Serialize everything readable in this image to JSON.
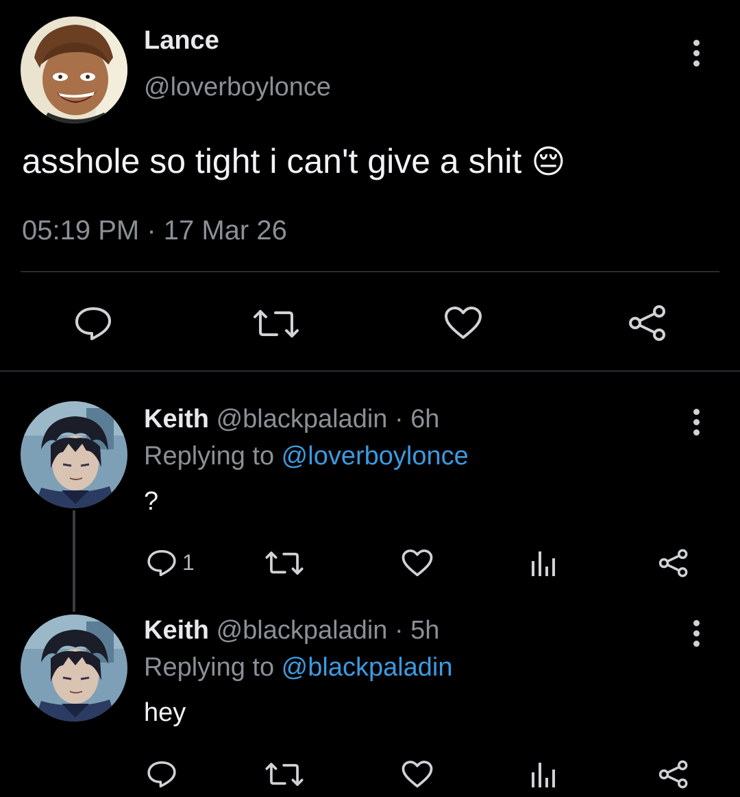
{
  "main_tweet": {
    "display_name": "Lance",
    "handle": "@loverboylonce",
    "text": "asshole so tight i can't give a shit",
    "emoji": "😔",
    "timestamp": "05:19 PM · 17 Mar 26",
    "actions": [
      "reply-icon",
      "retweet-icon",
      "like-icon",
      "share-icon"
    ]
  },
  "replies": [
    {
      "display_name": "Keith",
      "handle_time": "@blackpaladin · 6h",
      "replying_prefix": "Replying to ",
      "replying_to": "@loverboylonce",
      "text": "?",
      "reply_count": "1",
      "actions": [
        "reply-icon",
        "retweet-icon",
        "like-icon",
        "analytics-icon",
        "share-icon"
      ]
    },
    {
      "display_name": "Keith",
      "handle_time": "@blackpaladin · 5h",
      "replying_prefix": "Replying to ",
      "replying_to": "@blackpaladin",
      "text": "hey",
      "reply_count": "",
      "actions": [
        "reply-icon",
        "retweet-icon",
        "like-icon",
        "analytics-icon",
        "share-icon"
      ]
    }
  ],
  "colors": {
    "background": "#000000",
    "text": "#e7e9ea",
    "muted": "#8b9096",
    "link": "#3b9be0"
  }
}
